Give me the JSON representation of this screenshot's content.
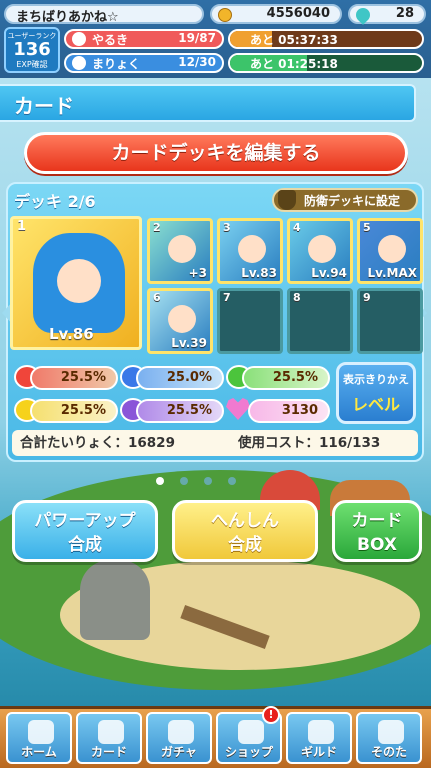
{
  "top": {
    "player_name": "まちばりあかね☆",
    "coins": "4556040",
    "gems": "28",
    "rank_label": "ユーザーランク",
    "rank_value": "136",
    "exp_label": "EXP確認",
    "stamina_label": "やるき",
    "stamina_value": "19/87",
    "stamina_timer": "あと 05:37:33",
    "magic_label": "まりょく",
    "magic_value": "12/30",
    "magic_timer": "あと 01:25:18"
  },
  "header": {
    "title": "カード"
  },
  "edit_button": "カードデッキを編集する",
  "deck": {
    "title": "デッキ 2/6",
    "defense_button": "防衛デッキに設定",
    "leader": {
      "index": "1",
      "level": "Lv.86"
    },
    "cards": [
      {
        "index": "2",
        "level": "+3",
        "empty": false
      },
      {
        "index": "3",
        "level": "Lv.83",
        "empty": false
      },
      {
        "index": "4",
        "level": "Lv.94",
        "empty": false
      },
      {
        "index": "5",
        "level": "Lv.MAX",
        "empty": false
      },
      {
        "index": "6",
        "level": "Lv.39",
        "empty": false
      },
      {
        "index": "7",
        "level": "",
        "empty": true
      },
      {
        "index": "8",
        "level": "",
        "empty": true
      },
      {
        "index": "9",
        "level": "",
        "empty": true
      }
    ],
    "stats": {
      "red": "25.5%",
      "blue": "25.0%",
      "green": "25.5%",
      "yellow": "25.5%",
      "purple": "25.5%",
      "heart": "3130"
    },
    "toggle": {
      "label": "表示きりかえ",
      "value": "レベル"
    },
    "total_stamina": "合計たいりょく：16829",
    "cost": "使用コスト：116/133"
  },
  "actions": {
    "powerup": [
      "パワーアップ",
      "合成"
    ],
    "transform": [
      "へんしん",
      "合成"
    ],
    "cardbox": [
      "カード",
      "BOX"
    ]
  },
  "nav": [
    "ホーム",
    "カード",
    "ガチャ",
    "ショップ",
    "ギルド",
    "そのた"
  ],
  "colors": {
    "red": "#f0453a",
    "blue": "#3a78e8",
    "green": "#4cc43c",
    "yellow": "#f6d21c",
    "purple": "#8a55d8",
    "heart": "#f07ad0"
  }
}
